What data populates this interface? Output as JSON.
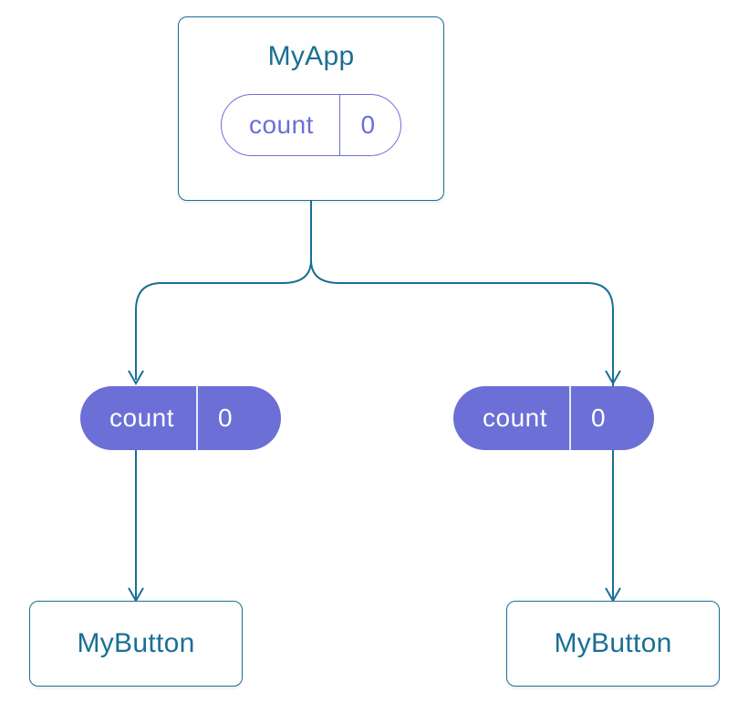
{
  "diagram": {
    "root": {
      "title": "MyApp",
      "state": {
        "label": "count",
        "value": "0"
      }
    },
    "propLeft": {
      "label": "count",
      "value": "0"
    },
    "propRight": {
      "label": "count",
      "value": "0"
    },
    "childLeft": {
      "title": "MyButton"
    },
    "childRight": {
      "title": "MyButton"
    }
  }
}
